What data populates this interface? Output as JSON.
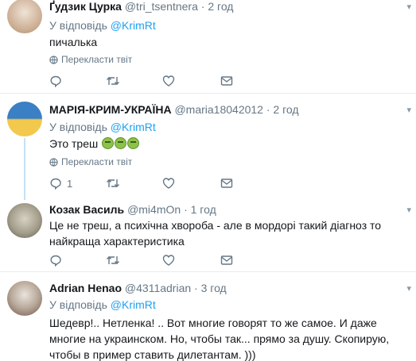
{
  "tweets": [
    {
      "name": "Ґудзик Цурка",
      "handle": "@tri_tsentnera",
      "dot": "·",
      "time": "2 год",
      "reply_prefix": "У відповідь",
      "reply_to": "@KrimRt",
      "text": "пичалька",
      "translate": "Перекласти твіт",
      "reply_count": "",
      "avatar_colors": [
        "#c9a98d",
        "#efe3d6"
      ]
    },
    {
      "name": "МАРІЯ-КРИМ-УКРАЇНА",
      "handle": "@maria18042012",
      "dot": "·",
      "time": "2 год",
      "reply_prefix": "У відповідь",
      "reply_to": "@KrimRt",
      "text": "Это треш",
      "translate": "Перекласти твіт",
      "reply_count": "1",
      "avatar_colors": [
        "#3b7fc4",
        "#f2c94c"
      ]
    },
    {
      "name": "Козак Василь",
      "handle": "@mi4mOn",
      "dot": "·",
      "time": "1 год",
      "reply_prefix": "",
      "reply_to": "",
      "text": "Це не треш, а психічна хвороба - але в мордорі такий діагноз то найкраща характеристика",
      "translate": "",
      "reply_count": "",
      "avatar_colors": [
        "#7a7566",
        "#d7d2c3"
      ]
    },
    {
      "name": "Adrian Henao",
      "handle": "@4311adrian",
      "dot": "·",
      "time": "3 год",
      "reply_prefix": "У відповідь",
      "reply_to": "@KrimRt",
      "text": "Шедевр!.. Нетленка! .. Вот многие говорят то же самое. И даже многие на украинском. Но, чтобы так... прямо за душу. Скопирую, чтобы в пример ставить дилетантам. )))",
      "translate": "",
      "reply_count": "",
      "avatar_colors": [
        "#8a6a55",
        "#e9e4dc"
      ]
    }
  ],
  "icons": {
    "reply": "reply-icon",
    "retweet": "retweet-icon",
    "like": "heart-icon",
    "dm": "envelope-icon",
    "globe": "globe-icon",
    "caret": "chevron-down-icon"
  },
  "colors": {
    "link": "#1da1f2",
    "secondary": "#657786",
    "text": "#14171a",
    "thread_line": "#c4e1f5",
    "divider": "#e6ecf0"
  }
}
